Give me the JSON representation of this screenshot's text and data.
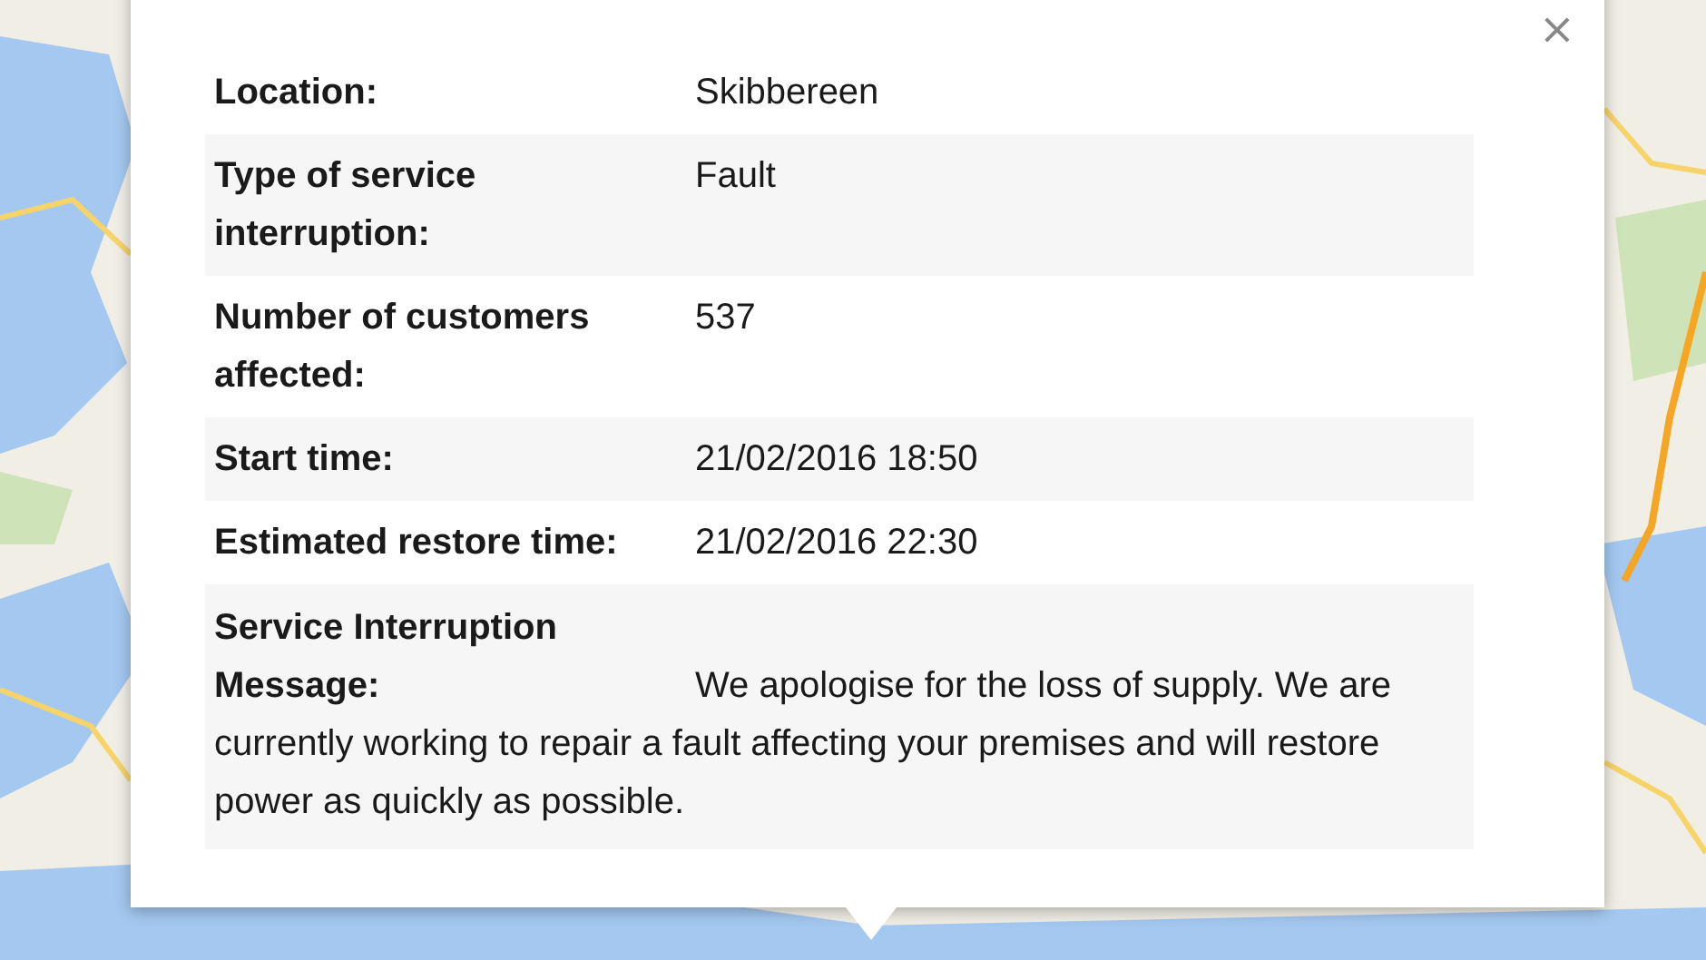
{
  "popup": {
    "close": "×",
    "rows": [
      {
        "kind": "field",
        "label": "Location:",
        "value": "Skibbereen"
      },
      {
        "kind": "field",
        "label": "Type of service interruption:",
        "value": "Fault"
      },
      {
        "kind": "field",
        "label": "Number of customers affected:",
        "value": "537"
      },
      {
        "kind": "field",
        "label": "Start time:",
        "value": "21/02/2016 18:50"
      },
      {
        "kind": "field",
        "label": "Estimated restore time:",
        "value": "21/02/2016 22:30"
      },
      {
        "kind": "message",
        "label": "Service Interruption Message:",
        "value": "We apologise for the loss of supply. We are currently working to repair a fault affecting your premises and will restore power as quickly as possible."
      }
    ]
  }
}
